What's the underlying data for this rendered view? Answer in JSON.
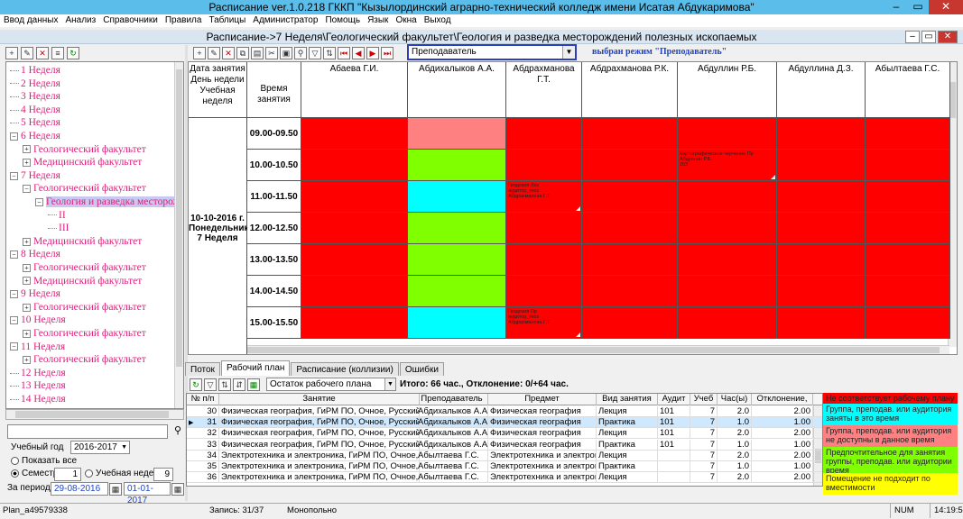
{
  "window": {
    "title": "Расписание ver.1.0.218 ГККП \"Кызылординский аграрно-технический колледж имени Исатая Абдукаримова\""
  },
  "menu": [
    "Ввод данных",
    "Анализ",
    "Справочники",
    "Правила",
    "Таблицы",
    "Администратор",
    "Помощь",
    "Язык",
    "Окна",
    "Выход"
  ],
  "subwindow": {
    "title": "Расписание->7 Неделя\\Геологический факультет\\Геология и разведка месторождений полезных ископаемых"
  },
  "tree": {
    "nodes": [
      {
        "label": "1 Неделя"
      },
      {
        "label": "2 Неделя"
      },
      {
        "label": "3 Неделя"
      },
      {
        "label": "4 Неделя"
      },
      {
        "label": "5 Неделя"
      },
      {
        "label": "6 Неделя"
      },
      {
        "label": "Геологический факультет"
      },
      {
        "label": "Медицинский факультет"
      },
      {
        "label": "7 Неделя"
      },
      {
        "label": "Геологический факультет"
      },
      {
        "label": "Геология и разведка месторож"
      },
      {
        "label": "II"
      },
      {
        "label": "III"
      },
      {
        "label": "Медицинский факультет"
      },
      {
        "label": "8 Неделя"
      },
      {
        "label": "Геологический факультет"
      },
      {
        "label": "Медицинский факультет"
      },
      {
        "label": "9 Неделя"
      },
      {
        "label": "Геологический факультет"
      },
      {
        "label": "10 Неделя"
      },
      {
        "label": "Геологический факультет"
      },
      {
        "label": "11 Неделя"
      },
      {
        "label": "Геологический факультет"
      },
      {
        "label": "12 Неделя"
      },
      {
        "label": "13 Неделя"
      },
      {
        "label": "14 Неделя"
      }
    ]
  },
  "filters": {
    "year_label": "Учебный год",
    "year_value": "2016-2017",
    "show_all": "Показать все",
    "semester_label": "Семестр",
    "semester_value": "1",
    "week_label": "Учебная неделя",
    "week_value": "9",
    "period_label": "За период",
    "period_from": "29-08-2016",
    "period_to": "01-01-2017"
  },
  "mode": {
    "combo_value": "Преподаватель",
    "text": "выбран режим \"Преподаватель\""
  },
  "schedule": {
    "corner": [
      "Дата занятия",
      "День недели",
      "Учебная",
      "неделя"
    ],
    "time_header": "Время занятия",
    "date_label": [
      "10-10-2016 г.",
      "Понедельник",
      "7 Неделя"
    ],
    "teachers": [
      "Абаева Г.И.",
      "Абдихалыков А.А.",
      "Абдрахманова Г.Т.",
      "Абдрахманова Р.К.",
      "Абдуллин Р.Б.",
      "Абдуллина Д.З.",
      "Абылтаева Г.С."
    ],
    "times": [
      "09.00-09.50",
      "10.00-10.50",
      "11.00-11.50",
      "12.00-12.50",
      "13.00-13.50",
      "14.00-14.50",
      "15.00-15.50"
    ],
    "notes": {
      "r1c4": [
        "Картографическое черчение Пр",
        "Абдуллин Р.Б.",
        "203"
      ],
      "r2c2": [
        "Геодезия Лек",
        "аудитор_геоз",
        "Абдрахманова Г.Т."
      ],
      "r6c2": [
        "Геодезия Пр",
        "аудитор_геоз",
        "Абдрахманова Г.Т."
      ]
    }
  },
  "tabs": [
    "Поток",
    "Рабочий план",
    "Расписание (коллизии)",
    "Ошибки"
  ],
  "workplan": {
    "combo_value": "Остаток рабочего плана",
    "total": "Итого: 66 час., Отклонение: 0/+64 час.",
    "headers": [
      "№ п/п",
      "Занятие",
      "Преподаватель",
      "Предмет",
      "Вид занятия",
      "Аудит",
      "Учеб",
      "Час(ы)",
      "Отклонение,"
    ],
    "rows": [
      {
        "n": "30",
        "lesson": "Физическая география, ГиРМ ПО, Очное, Русский, Геол",
        "teacher": "Абдихалыков А.А.",
        "subject": "Физическая география",
        "kind": "Лекция",
        "room": "101",
        "week": "7",
        "hours": "2.0",
        "dev": "2.00"
      },
      {
        "n": "31",
        "lesson": "Физическая география, ГиРМ ПО, Очное, Русский, Геол",
        "teacher": "Абдихалыков А.А.",
        "subject": "Физическая география",
        "kind": "Практика",
        "room": "101",
        "week": "7",
        "hours": "1.0",
        "dev": "1.00"
      },
      {
        "n": "32",
        "lesson": "Физическая география, ГиРМ ПО, Очное, Русский, Геол",
        "teacher": "Абдихалыков А.А.",
        "subject": "Физическая география",
        "kind": "Лекция",
        "room": "101",
        "week": "7",
        "hours": "2.0",
        "dev": "2.00"
      },
      {
        "n": "33",
        "lesson": "Физическая география, ГиРМ ПО, Очное, Русский, Геол",
        "teacher": "Абдихалыков А.А.",
        "subject": "Физическая география",
        "kind": "Практика",
        "room": "101",
        "week": "7",
        "hours": "1.0",
        "dev": "1.00"
      },
      {
        "n": "34",
        "lesson": "Электротехника и электроника, ГиРМ ПО, Очное, Русск",
        "teacher": "Абылтаева Г.С.",
        "subject": "Электротехника и электроника",
        "kind": "Лекция",
        "room": "",
        "week": "7",
        "hours": "2.0",
        "dev": "2.00"
      },
      {
        "n": "35",
        "lesson": "Электротехника и электроника, ГиРМ ПО, Очное, Русск",
        "teacher": "Абылтаева Г.С.",
        "subject": "Электротехника и электроника",
        "kind": "Практика",
        "room": "",
        "week": "7",
        "hours": "1.0",
        "dev": "1.00"
      },
      {
        "n": "36",
        "lesson": "Электротехника и электроника, ГиРМ ПО, Очное, Русск",
        "teacher": "Абылтаева Г.С.",
        "subject": "Электротехника и электроника",
        "kind": "Лекция",
        "room": "",
        "week": "7",
        "hours": "2.0",
        "dev": "2.00"
      }
    ]
  },
  "legend": [
    {
      "text": "Не соответствует рабочему плану",
      "color": "#ff0000"
    },
    {
      "text": "Группа, преподав. или аудитория заняты в это время",
      "color": "#00ffff"
    },
    {
      "text": "Группа, преподав. или аудитория не доступны в данное время",
      "color": "#ff8080"
    },
    {
      "text": "Предпочтительное для занятия группы, преподав. или аудитории время",
      "color": "#80ff00"
    },
    {
      "text": "Помещение не подходит по вместимости",
      "color": "#ffff00"
    }
  ],
  "status": {
    "plan": "Plan_a49579338",
    "record": "Запись: 31/37",
    "mode": "Монопольно",
    "num": "NUM",
    "time": "14:19:55"
  },
  "colors": {
    "red": "#ff0000",
    "pink": "#ff8080",
    "green": "#80ff00",
    "cyan": "#00ffff"
  }
}
